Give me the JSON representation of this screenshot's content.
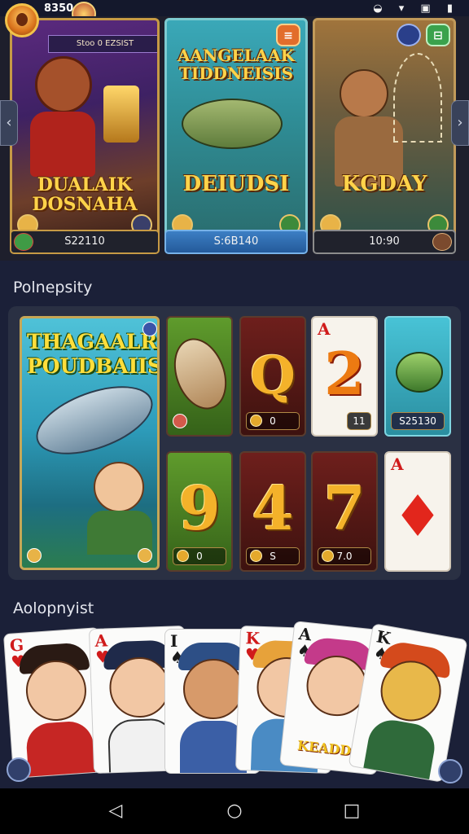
{
  "status": {
    "time": "8350",
    "icons": "◒ ▾ ▣ ▮"
  },
  "top": {
    "cards": [
      {
        "title": "DUALAIK DOSNAHA",
        "value": "S22110",
        "corner_pill": ""
      },
      {
        "title": "AANGELAAK TIDDNEISIS",
        "subtitle": "DEIUDSI",
        "value": "S:6B140",
        "corner_pill": "≡"
      },
      {
        "title": "KGDAY",
        "value": "10:90",
        "corner_pill": "⊟"
      }
    ],
    "banner_note": "Stoo 0 EZSIST"
  },
  "sections": {
    "grid_title": "Polnepsity",
    "fan_title": "Aolopnyist"
  },
  "grid": {
    "feature_title": "THAGAALR POUDBAIIS",
    "tiles": [
      {
        "glyph": "",
        "foot": ""
      },
      {
        "glyph": "Q",
        "foot": "0"
      },
      {
        "glyph": "2",
        "corner": "A",
        "foot": "11"
      },
      {
        "glyph": "",
        "foot": "S25130"
      },
      {
        "glyph": "9",
        "foot": "0"
      },
      {
        "glyph": "4",
        "foot": "S"
      },
      {
        "glyph": "7",
        "foot": "7.0"
      },
      {
        "glyph": "♦",
        "corner": "A",
        "foot": ""
      }
    ]
  },
  "fan": {
    "cards": [
      {
        "rank": "G",
        "suit": "♥"
      },
      {
        "rank": "A",
        "suit": "♥"
      },
      {
        "rank": "I",
        "suit": "♠"
      },
      {
        "rank": "K",
        "suit": "♥"
      },
      {
        "rank": "A",
        "suit": "♠"
      },
      {
        "rank": "K",
        "suit": "♠"
      }
    ],
    "wordmark": "KEADDN"
  },
  "navbar": {
    "back": "◁",
    "home": "○",
    "recents": "□"
  }
}
